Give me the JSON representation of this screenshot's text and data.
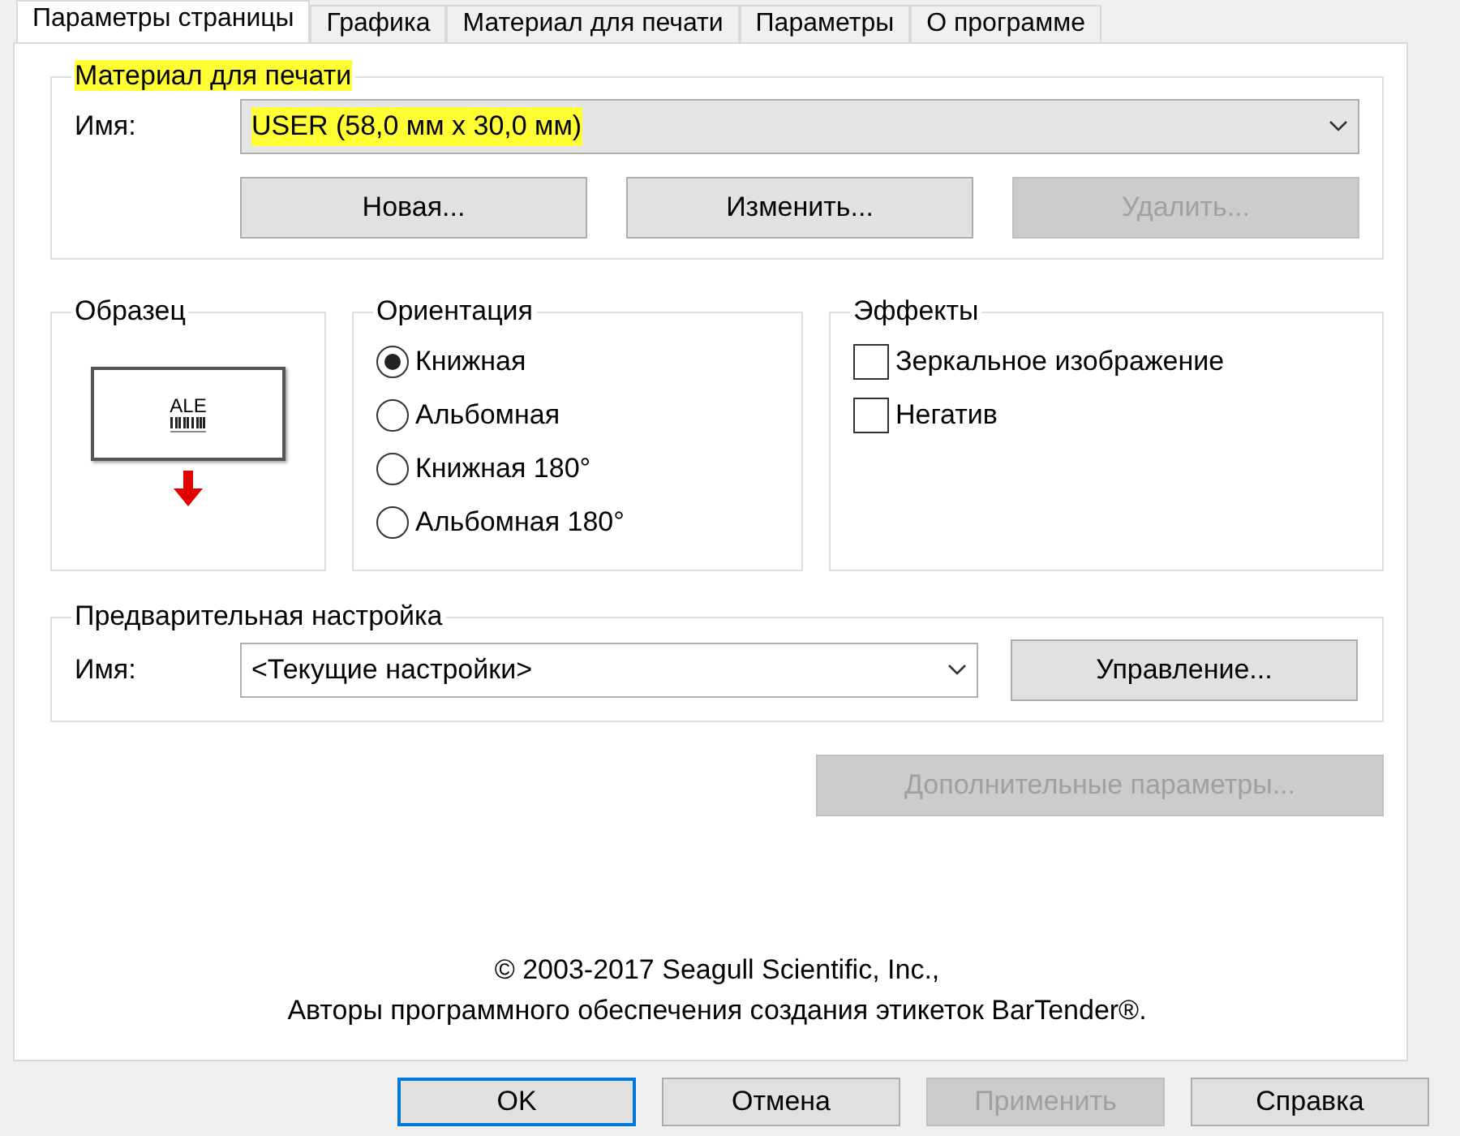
{
  "tabs": [
    {
      "label": "Параметры страницы",
      "selected": true
    },
    {
      "label": "Графика",
      "selected": false
    },
    {
      "label": "Материал для печати",
      "selected": false
    },
    {
      "label": "Параметры",
      "selected": false
    },
    {
      "label": "О программе",
      "selected": false
    }
  ],
  "media": {
    "title": "Материал для печати",
    "highlighted": true,
    "name_label": "Имя:",
    "name_value": "USER (58,0 мм x 30,0 мм)",
    "buttons": [
      {
        "label": "Новая...",
        "disabled": false
      },
      {
        "label": "Изменить...",
        "disabled": false
      },
      {
        "label": "Удалить...",
        "disabled": true
      }
    ]
  },
  "sample": {
    "title": "Образец",
    "label_text": "ALE"
  },
  "orientation": {
    "title": "Ориентация",
    "options": [
      {
        "label": "Книжная",
        "selected": true
      },
      {
        "label": "Альбомная",
        "selected": false
      },
      {
        "label": "Книжная 180°",
        "selected": false
      },
      {
        "label": "Альбомная 180°",
        "selected": false
      }
    ]
  },
  "effects": {
    "title": "Эффекты",
    "options": [
      {
        "label": "Зеркальное изображение",
        "checked": false
      },
      {
        "label": "Негатив",
        "checked": false
      }
    ]
  },
  "preset": {
    "title": "Предварительная настройка",
    "name_label": "Имя:",
    "name_value": "<Текущие настройки>",
    "manage_button": "Управление..."
  },
  "advanced_button": {
    "label": "Дополнительные параметры...",
    "disabled": true
  },
  "copyright": [
    "© 2003-2017 Seagull Scientific, Inc.,",
    "Авторы программного обеспечения создания этикеток BarTender®."
  ],
  "dialog_buttons": [
    {
      "label": "OK",
      "disabled": false,
      "default": true
    },
    {
      "label": "Отмена",
      "disabled": false,
      "default": false
    },
    {
      "label": "Применить",
      "disabled": true,
      "default": false
    },
    {
      "label": "Справка",
      "disabled": false,
      "default": false
    }
  ]
}
